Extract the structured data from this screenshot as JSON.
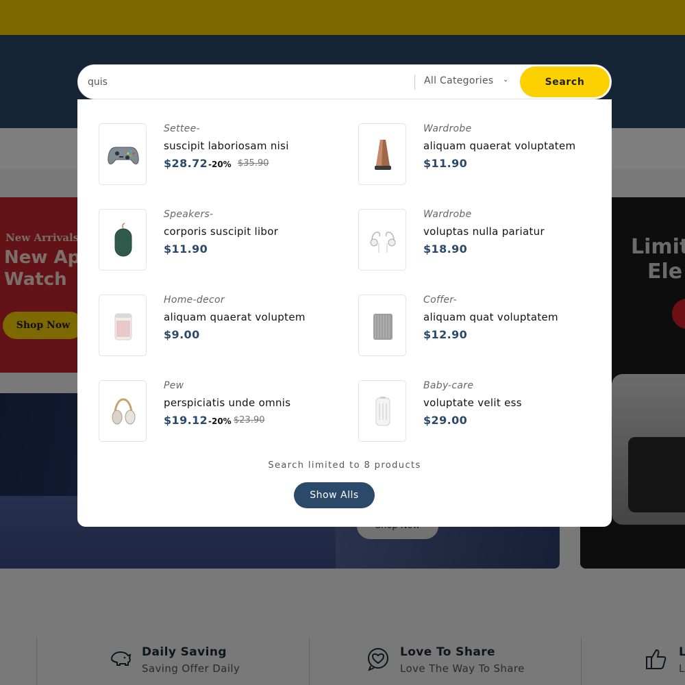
{
  "search": {
    "query": "quis",
    "category": "All Categories",
    "button_label": "Search"
  },
  "results": [
    {
      "category": "Settee-",
      "name": "suscipit laboriosam nisi",
      "price": "$28.72",
      "discount": "-20%",
      "old_price": "$35.90",
      "icon": "game-controller-icon"
    },
    {
      "category": "Wardrobe",
      "name": "aliquam quaerat voluptatem",
      "price": "$11.90",
      "discount": "",
      "old_price": "",
      "icon": "speaker-icon"
    },
    {
      "category": "Speakers-",
      "name": "corporis suscipit libor",
      "price": "$11.90",
      "discount": "",
      "old_price": "",
      "icon": "portable-speaker-icon"
    },
    {
      "category": "Wardrobe",
      "name": "voluptas nulla pariatur",
      "price": "$18.90",
      "discount": "",
      "old_price": "",
      "icon": "earphones-icon"
    },
    {
      "category": "Home-decor",
      "name": "aliquam quaerat voluptem",
      "price": "$9.00",
      "discount": "",
      "old_price": "",
      "icon": "air-purifier-icon"
    },
    {
      "category": "Coffer-",
      "name": "aliquam quat voluptatem",
      "price": "$12.90",
      "discount": "",
      "old_price": "",
      "icon": "grey-speaker-icon"
    },
    {
      "category": "Pew",
      "name": "perspiciatis unde omnis",
      "price": "$19.12",
      "discount": "-20%",
      "old_price": "$23.90",
      "icon": "headphones-icon"
    },
    {
      "category": "Baby-care",
      "name": "voluptate velit ess",
      "price": "$29.00",
      "discount": "",
      "old_price": "",
      "icon": "heater-icon"
    }
  ],
  "limit_text": "Search limited to 8 products",
  "show_all_label": "Show Alls",
  "banners": {
    "left": {
      "kicker": "New Arrivals",
      "title_line1": "New Ap",
      "title_line2": "Watch",
      "button": "Shop Now"
    },
    "bottom": {
      "button": "Shop Now"
    },
    "right": {
      "title_line1": "Limit",
      "title_line2": "Ele"
    }
  },
  "features": [
    {
      "title": "Daily Saving",
      "subtitle": "Saving Offer Daily",
      "icon": "piggy-bank-icon"
    },
    {
      "title": "Love To Share",
      "subtitle": "Love The Way To Share",
      "icon": "heart-chat-icon"
    },
    {
      "title": "L",
      "subtitle": "L",
      "icon": "thumbs-up-icon"
    }
  ],
  "colors": {
    "brand_yellow": "#fdd100",
    "brand_navy": "#2b4a6a"
  }
}
